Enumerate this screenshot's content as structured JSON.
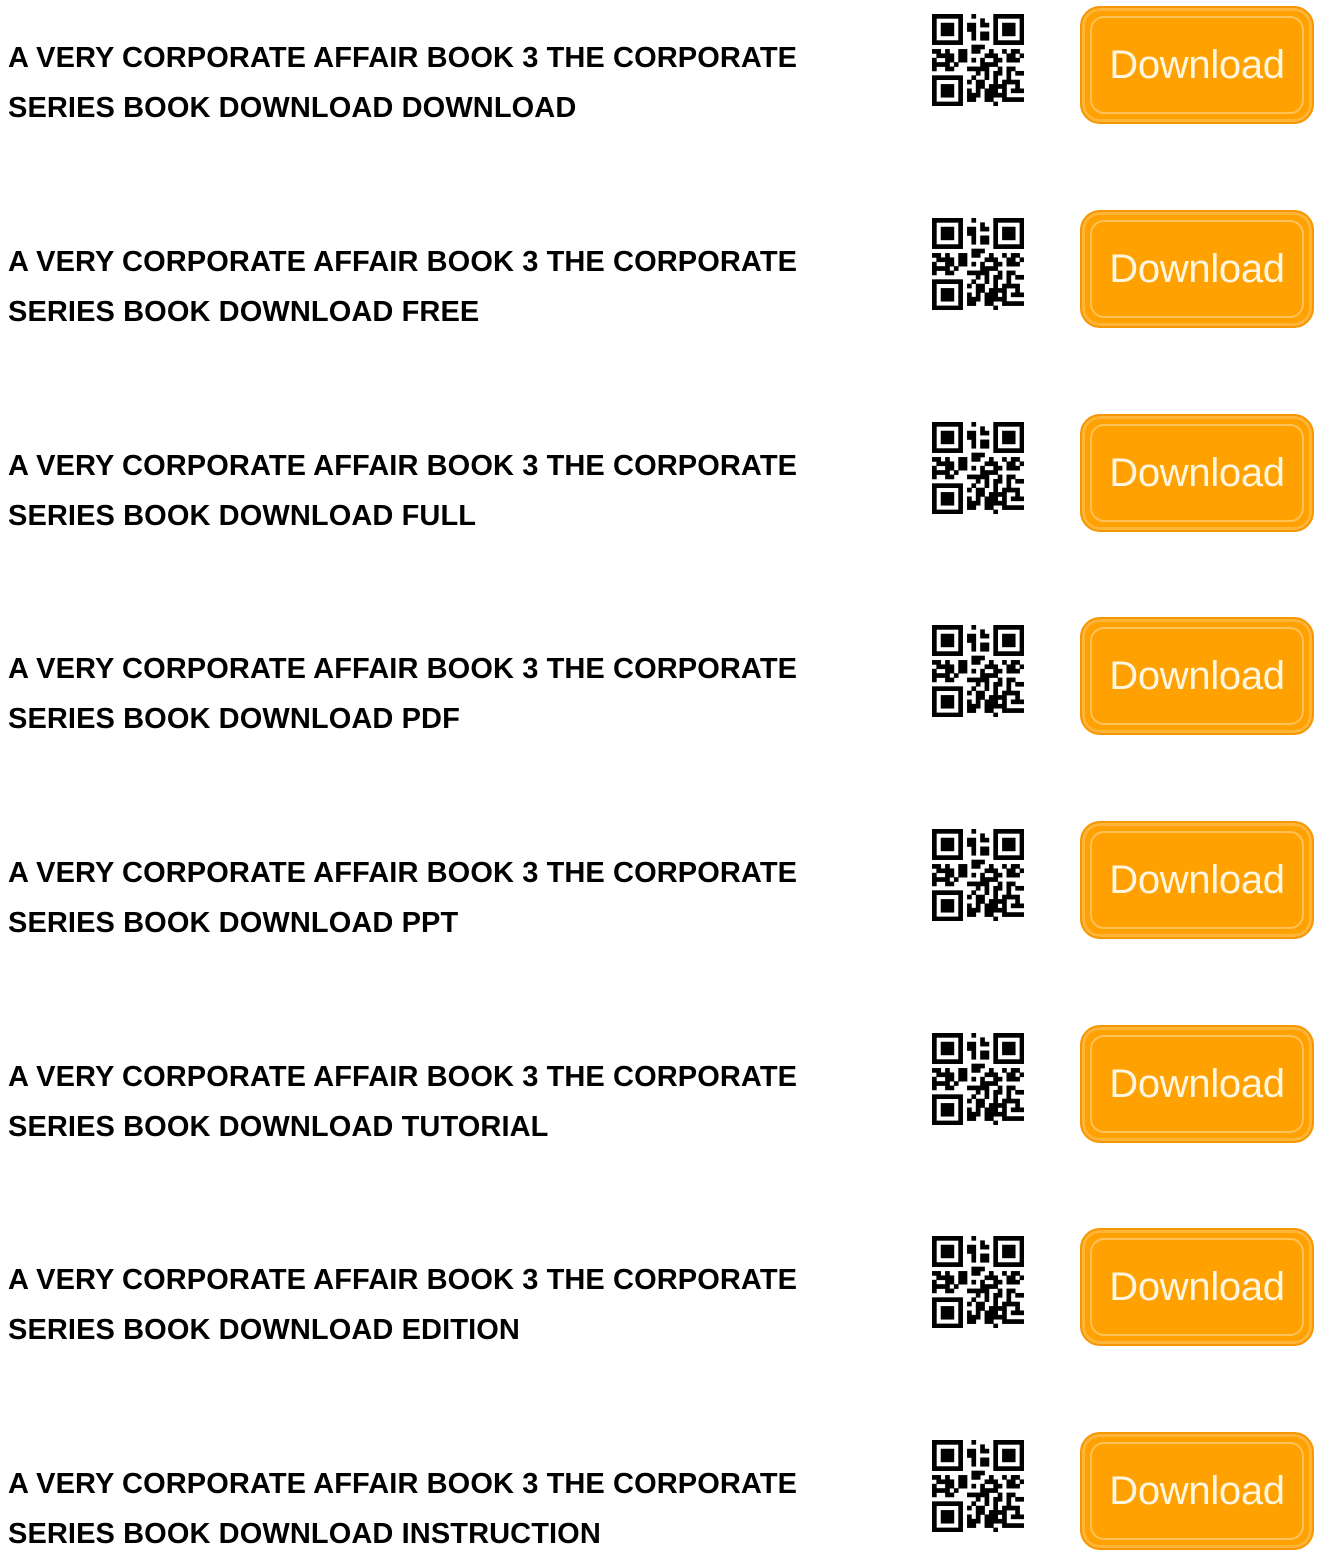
{
  "items": [
    {
      "title_line1": "A VERY CORPORATE AFFAIR BOOK 3 THE CORPORATE",
      "title_line2": "SERIES BOOK DOWNLOAD DOWNLOAD",
      "button_label": "Download"
    },
    {
      "title_line1": "A VERY CORPORATE AFFAIR BOOK 3 THE CORPORATE",
      "title_line2": "SERIES BOOK DOWNLOAD FREE",
      "button_label": "Download"
    },
    {
      "title_line1": "A VERY CORPORATE AFFAIR BOOK 3 THE CORPORATE",
      "title_line2": "SERIES BOOK DOWNLOAD FULL",
      "button_label": "Download"
    },
    {
      "title_line1": "A VERY CORPORATE AFFAIR BOOK 3 THE CORPORATE",
      "title_line2": "SERIES BOOK DOWNLOAD PDF",
      "button_label": "Download"
    },
    {
      "title_line1": "A VERY CORPORATE AFFAIR BOOK 3 THE CORPORATE",
      "title_line2": "SERIES BOOK DOWNLOAD PPT",
      "button_label": "Download"
    },
    {
      "title_line1": "A VERY CORPORATE AFFAIR BOOK 3 THE CORPORATE",
      "title_line2": "SERIES BOOK DOWNLOAD TUTORIAL",
      "button_label": "Download"
    },
    {
      "title_line1": "A VERY CORPORATE AFFAIR BOOK 3 THE CORPORATE",
      "title_line2": "SERIES BOOK DOWNLOAD EDITION",
      "button_label": "Download"
    },
    {
      "title_line1": "A VERY CORPORATE AFFAIR BOOK 3 THE CORPORATE",
      "title_line2": "SERIES BOOK DOWNLOAD INSTRUCTION",
      "button_label": "Download"
    }
  ],
  "icons": {
    "qr": "qr-code-icon"
  },
  "colors": {
    "button": "#ffa100",
    "button_text": "#fff6e2",
    "title_text": "#000000"
  }
}
